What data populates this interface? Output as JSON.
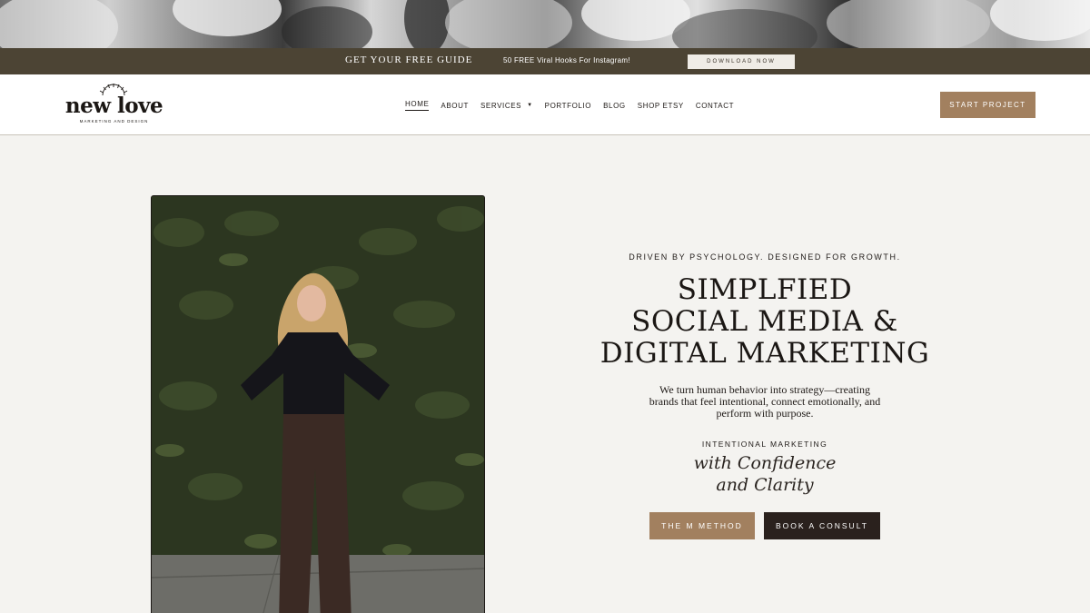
{
  "promo": {
    "title": "GET YOUR FREE GUIDE",
    "text": "50 FREE Viral Hooks For Instagram!",
    "button": "DOWNLOAD NOW"
  },
  "header": {
    "logo": {
      "word": "new love",
      "sub": "MARKETING AND DESIGN"
    },
    "nav": [
      {
        "label": "HOME"
      },
      {
        "label": "ABOUT"
      },
      {
        "label": "SERVICES"
      },
      {
        "label": "PORTFOLIO"
      },
      {
        "label": "BLOG"
      },
      {
        "label": "SHOP ETSY"
      },
      {
        "label": "CONTACT"
      }
    ],
    "cta": "START PROJECT"
  },
  "hero": {
    "eyebrow": "DRIVEN BY PSYCHOLOGY. DESIGNED FOR GROWTH.",
    "headline_lines": [
      "SIMPLFIED",
      "SOCIAL MEDIA &",
      "DIGITAL MARKETING"
    ],
    "subtext": "We turn human behavior into strategy—creating brands that feel intentional, connect emotionally, and perform with purpose.",
    "tag": "INTENTIONAL MARKETING",
    "script_lines": [
      "with Confidence",
      "and Clarity"
    ],
    "buttons": {
      "primary": "THE M METHOD",
      "secondary": "BOOK A CONSULT"
    }
  },
  "colors": {
    "promo_bg": "#4c4434",
    "accent": "#a2805f",
    "dark_button": "#2a211d",
    "page_bg": "#f4f3f0"
  },
  "icons": [
    "sunburst-logo-icon",
    "chevron-down-icon"
  ]
}
